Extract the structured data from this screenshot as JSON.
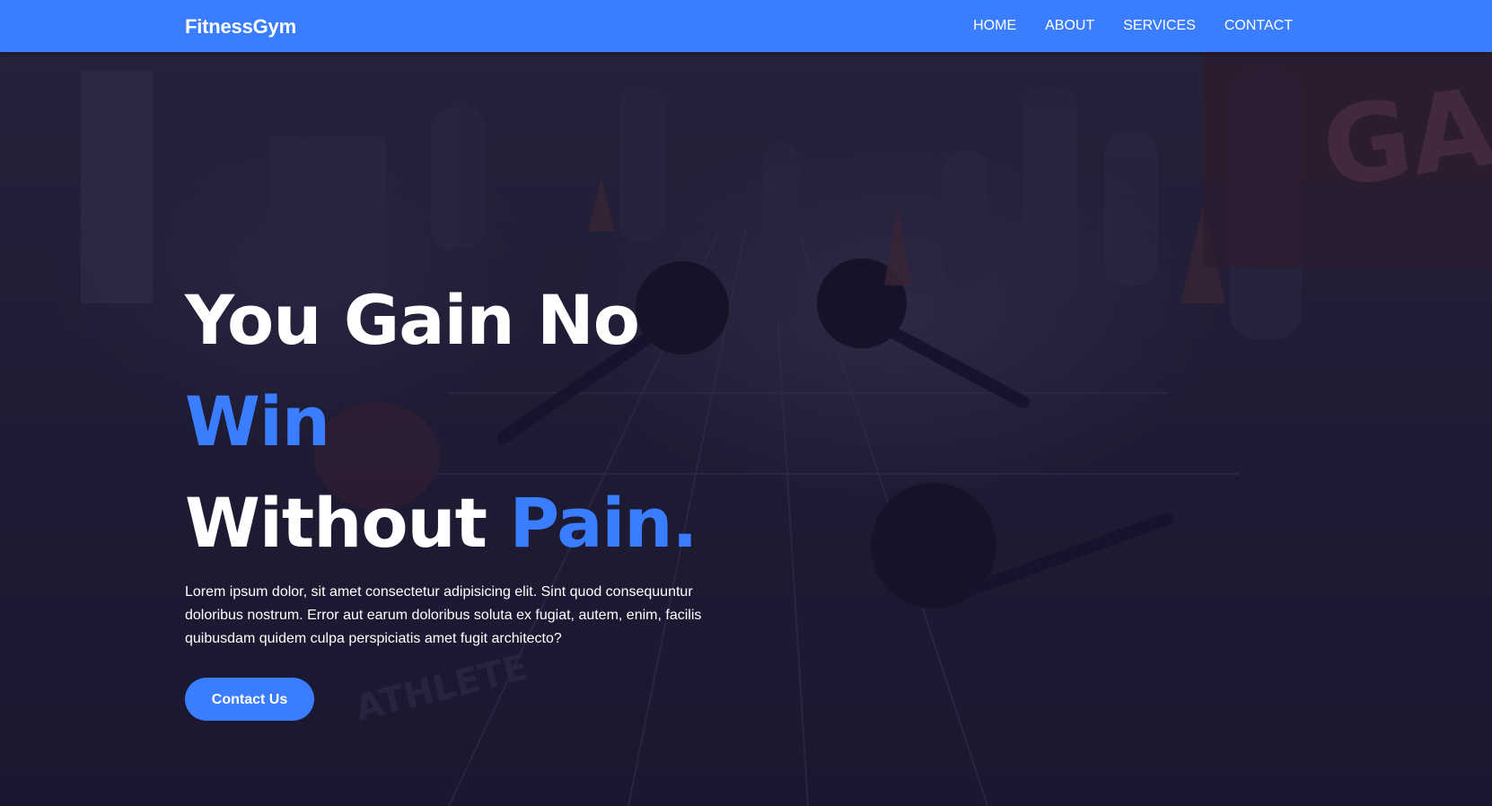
{
  "nav": {
    "brand": "FitnessGym",
    "links": [
      {
        "label": "HOME"
      },
      {
        "label": "ABOUT"
      },
      {
        "label": "SERVICES"
      },
      {
        "label": "CONTACT"
      }
    ]
  },
  "hero": {
    "line1": "You Gain No",
    "line2": "Win",
    "line3_white": "Without ",
    "line3_accent": "Pain.",
    "description": "Lorem ipsum dolor, sit amet consectetur adipisicing elit. Sint quod consequuntur doloribus nostrum. Error aut earum doloribus soluta ex fugiat, autem, enim, facilis quibusdam quidem culpa perspiciatis amet fugit architecto?",
    "cta_label": "Contact Us",
    "background": "dark-gym-photo",
    "background_mark_text": "ATHLETE"
  },
  "colors": {
    "accent": "#3a7dff",
    "overlay": "#1a1730",
    "text": "#ffffff"
  }
}
